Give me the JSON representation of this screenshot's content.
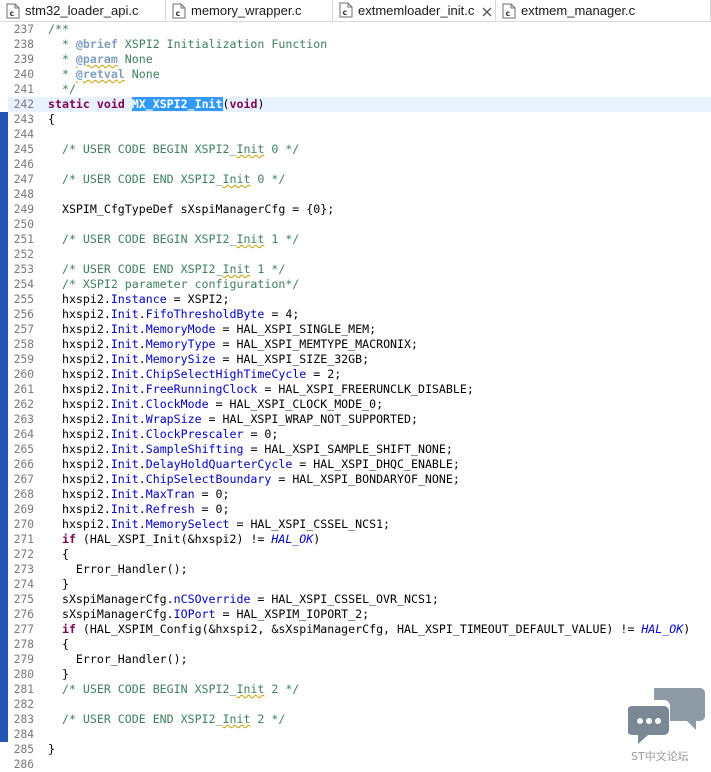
{
  "tabs": [
    {
      "label": "stm32_loader_api.c",
      "active": false
    },
    {
      "label": "memory_wrapper.c",
      "active": false
    },
    {
      "label": "extmemloader_init.c",
      "active": true
    },
    {
      "label": "extmem_manager.c",
      "active": false
    }
  ],
  "editor": {
    "current_line": 242,
    "lines": [
      {
        "n": "237",
        "text": "/**"
      },
      {
        "n": "238",
        "text": "  * @brief XSPI2 Initialization Function"
      },
      {
        "n": "239",
        "text": "  * @param None"
      },
      {
        "n": "240",
        "text": "  * @retval None"
      },
      {
        "n": "241",
        "text": "  */"
      },
      {
        "n": "242",
        "text": "static void MX_XSPI2_Init(void)"
      },
      {
        "n": "243",
        "text": "{"
      },
      {
        "n": "244",
        "text": ""
      },
      {
        "n": "245",
        "text": "  /* USER CODE BEGIN XSPI2_Init 0 */"
      },
      {
        "n": "246",
        "text": ""
      },
      {
        "n": "247",
        "text": "  /* USER CODE END XSPI2_Init 0 */"
      },
      {
        "n": "248",
        "text": ""
      },
      {
        "n": "249",
        "text": "  XSPIM_CfgTypeDef sXspiManagerCfg = {0};"
      },
      {
        "n": "250",
        "text": ""
      },
      {
        "n": "251",
        "text": "  /* USER CODE BEGIN XSPI2_Init 1 */"
      },
      {
        "n": "252",
        "text": ""
      },
      {
        "n": "253",
        "text": "  /* USER CODE END XSPI2_Init 1 */"
      },
      {
        "n": "254",
        "text": "  /* XSPI2 parameter configuration*/"
      },
      {
        "n": "255",
        "text": "  hxspi2.Instance = XSPI2;"
      },
      {
        "n": "256",
        "text": "  hxspi2.Init.FifoThresholdByte = 4;"
      },
      {
        "n": "257",
        "text": "  hxspi2.Init.MemoryMode = HAL_XSPI_SINGLE_MEM;"
      },
      {
        "n": "258",
        "text": "  hxspi2.Init.MemoryType = HAL_XSPI_MEMTYPE_MACRONIX;"
      },
      {
        "n": "259",
        "text": "  hxspi2.Init.MemorySize = HAL_XSPI_SIZE_32GB;"
      },
      {
        "n": "260",
        "text": "  hxspi2.Init.ChipSelectHighTimeCycle = 2;"
      },
      {
        "n": "261",
        "text": "  hxspi2.Init.FreeRunningClock = HAL_XSPI_FREERUNCLK_DISABLE;"
      },
      {
        "n": "262",
        "text": "  hxspi2.Init.ClockMode = HAL_XSPI_CLOCK_MODE_0;"
      },
      {
        "n": "263",
        "text": "  hxspi2.Init.WrapSize = HAL_XSPI_WRAP_NOT_SUPPORTED;"
      },
      {
        "n": "264",
        "text": "  hxspi2.Init.ClockPrescaler = 0;"
      },
      {
        "n": "265",
        "text": "  hxspi2.Init.SampleShifting = HAL_XSPI_SAMPLE_SHIFT_NONE;"
      },
      {
        "n": "266",
        "text": "  hxspi2.Init.DelayHoldQuarterCycle = HAL_XSPI_DHQC_ENABLE;"
      },
      {
        "n": "267",
        "text": "  hxspi2.Init.ChipSelectBoundary = HAL_XSPI_BONDARYOF_NONE;"
      },
      {
        "n": "268",
        "text": "  hxspi2.Init.MaxTran = 0;"
      },
      {
        "n": "269",
        "text": "  hxspi2.Init.Refresh = 0;"
      },
      {
        "n": "270",
        "text": "  hxspi2.Init.MemorySelect = HAL_XSPI_CSSEL_NCS1;"
      },
      {
        "n": "271",
        "text": "  if (HAL_XSPI_Init(&hxspi2) != HAL_OK)"
      },
      {
        "n": "272",
        "text": "  {"
      },
      {
        "n": "273",
        "text": "    Error_Handler();"
      },
      {
        "n": "274",
        "text": "  }"
      },
      {
        "n": "275",
        "text": "  sXspiManagerCfg.nCSOverride = HAL_XSPI_CSSEL_OVR_NCS1;"
      },
      {
        "n": "276",
        "text": "  sXspiManagerCfg.IOPort = HAL_XSPIM_IOPORT_2;"
      },
      {
        "n": "277",
        "text": "  if (HAL_XSPIM_Config(&hxspi2, &sXspiManagerCfg, HAL_XSPI_TIMEOUT_DEFAULT_VALUE) != HAL_OK)"
      },
      {
        "n": "278",
        "text": "  {"
      },
      {
        "n": "279",
        "text": "    Error_Handler();"
      },
      {
        "n": "280",
        "text": "  }"
      },
      {
        "n": "281",
        "text": "  /* USER CODE BEGIN XSPI2_Init 2 */"
      },
      {
        "n": "282",
        "text": ""
      },
      {
        "n": "283",
        "text": "  /* USER CODE END XSPI2_Init 2 */"
      },
      {
        "n": "284",
        "text": ""
      },
      {
        "n": "285",
        "text": "}"
      },
      {
        "n": "286",
        "text": ""
      }
    ]
  },
  "watermark": {
    "text": "ST中文论坛"
  }
}
